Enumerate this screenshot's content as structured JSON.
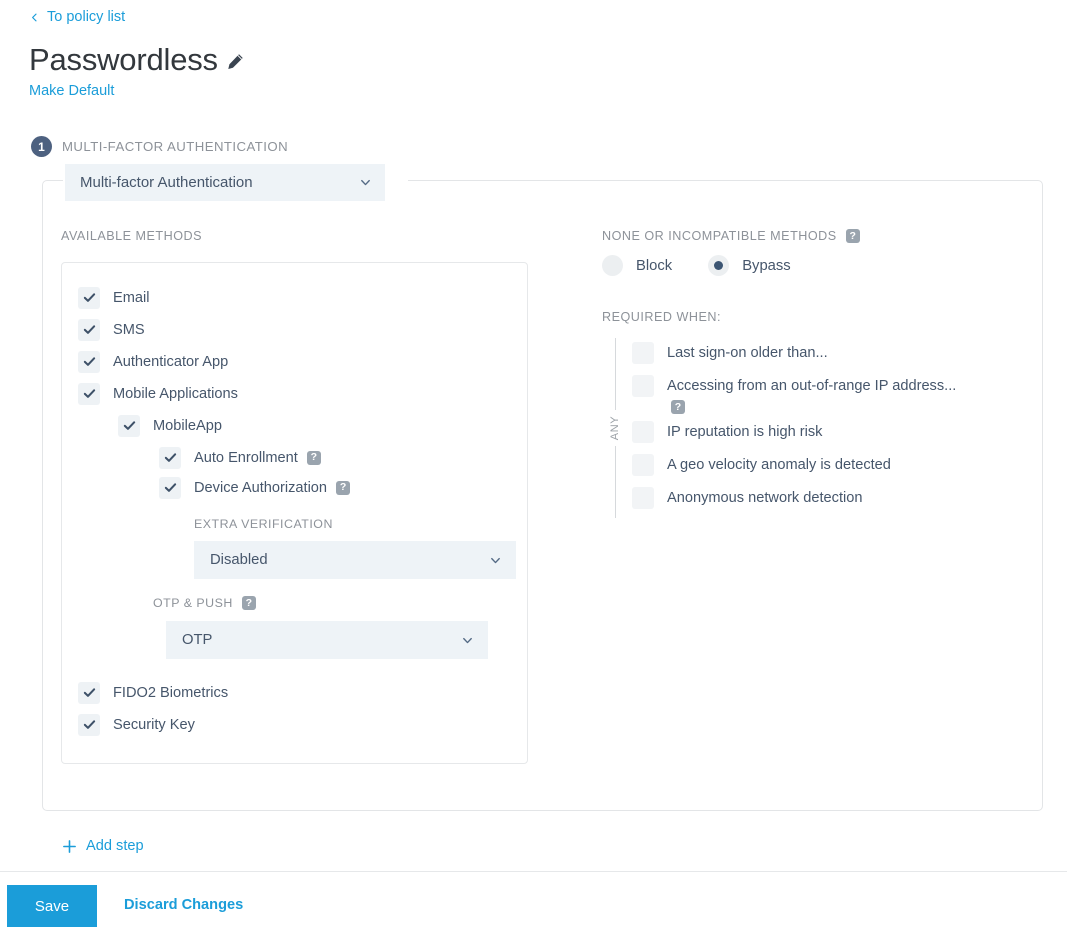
{
  "header": {
    "back_link": "To policy list",
    "back_icon": "chevron-left-icon",
    "title": "Passwordless",
    "edit_icon": "pencil-icon",
    "make_default": "Make Default"
  },
  "step": {
    "number": "1",
    "title": "MULTI-FACTOR AUTHENTICATION",
    "type_select": {
      "value": "Multi-factor Authentication",
      "icon": "chevron-down-icon"
    }
  },
  "left": {
    "section_label": "AVAILABLE METHODS",
    "methods": [
      {
        "label": "Email",
        "checked": true,
        "indent": 0
      },
      {
        "label": "SMS",
        "checked": true,
        "indent": 0
      },
      {
        "label": "Authenticator App",
        "checked": true,
        "indent": 0
      },
      {
        "label": "Mobile Applications",
        "checked": true,
        "indent": 0
      },
      {
        "label": "MobileApp",
        "checked": true,
        "indent": 1
      },
      {
        "label": "Auto Enrollment",
        "checked": true,
        "indent": 2,
        "help": true
      },
      {
        "label": "Device Authorization",
        "checked": true,
        "indent": 2,
        "help": true
      }
    ],
    "extra_verification": {
      "label": "EXTRA VERIFICATION",
      "value": "Disabled",
      "icon": "chevron-down-icon"
    },
    "otp_push": {
      "label": "OTP & PUSH",
      "help": true,
      "value": "OTP",
      "icon": "chevron-down-icon"
    },
    "methods_tail": [
      {
        "label": "FIDO2 Biometrics",
        "checked": true,
        "indent": 0
      },
      {
        "label": "Security Key",
        "checked": true,
        "indent": 0
      }
    ]
  },
  "right": {
    "none_label": "NONE OR INCOMPATIBLE METHODS",
    "none_help": true,
    "radios": [
      {
        "label": "Block",
        "selected": false
      },
      {
        "label": "Bypass",
        "selected": true
      }
    ],
    "required_label": "REQUIRED WHEN:",
    "any_label": "ANY",
    "conditions": [
      {
        "label": "Last sign-on older than...",
        "checked": false,
        "help": false
      },
      {
        "label": "Accessing from an out-of-range IP address...",
        "checked": false,
        "help": true
      },
      {
        "label": "IP reputation is high risk",
        "checked": false,
        "help": false
      },
      {
        "label": "A geo velocity anomaly is detected",
        "checked": false,
        "help": false
      },
      {
        "label": "Anonymous network detection",
        "checked": false,
        "help": false
      }
    ]
  },
  "footer": {
    "add_step": "Add step",
    "add_icon": "plus-icon",
    "save": "Save",
    "discard": "Discard Changes"
  },
  "colors": {
    "link": "#1b9dd9",
    "primary_button": "#1b9dd9",
    "title": "#33383d",
    "label": "#8d9299",
    "text": "#46566b",
    "badge": "#4d6180",
    "field_bg": "#eef3f7",
    "checkbox_bg": "#eef2f5"
  }
}
